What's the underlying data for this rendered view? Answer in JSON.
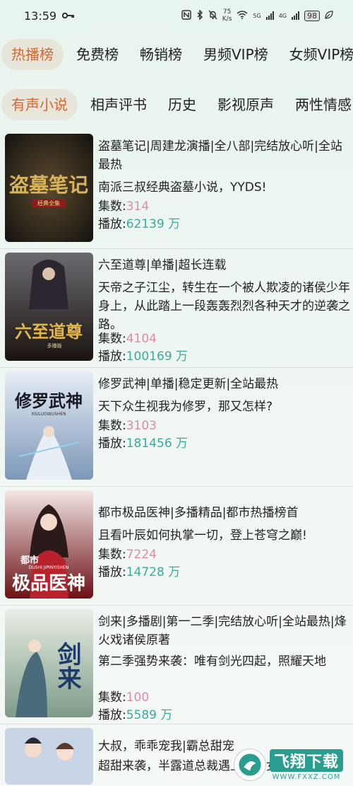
{
  "status_bar": {
    "time": "13:59",
    "net_speed_value": "75",
    "net_speed_unit": "K/s",
    "signal1_label": "5G",
    "signal2_label": "4G",
    "battery": "98"
  },
  "category_tabs": [
    "热播榜",
    "免费榜",
    "畅销榜",
    "男频VIP榜",
    "女频VIP榜"
  ],
  "genre_tabs": [
    "有声小说",
    "相声评书",
    "历史",
    "影视原声",
    "两性情感"
  ],
  "labels": {
    "episodes": "集数:",
    "plays": "播放:",
    "plays_unit": " 万"
  },
  "books": [
    {
      "title": "盗墓笔记|周建龙演播|全八部|完结放心听|全站最热",
      "desc": "南派三叔经典盗墓小说，YYDS!",
      "episodes": "314",
      "plays": "62139",
      "cover_text": "盗墓笔记",
      "cover_sub": "经典全集",
      "cover_color": "#2b2a26"
    },
    {
      "title": "六至道尊|单播|超长连载",
      "desc": "天帝之子江尘，转生在一个被人欺凌的诸侯少年身上，从此踏上一段轰轰烈烈各种天才的逆袭之路。",
      "episodes": "4104",
      "plays": "100169",
      "cover_text": "六至道尊",
      "cover_sub": "多播版",
      "cover_color": "#3b2f22"
    },
    {
      "title": "修罗武神|单播|稳定更新|全站最热",
      "desc": "天下众生视我为修罗，那又怎样?",
      "episodes": "3103",
      "plays": "181456",
      "cover_text": "修罗武神",
      "cover_sub": "XIULUOWUSHEN",
      "cover_color": "#b9c9d8"
    },
    {
      "title": "都市极品医神|多播精品|都市热播榜首",
      "desc": "且看叶辰如何执掌一切，登上苍穹之巅!",
      "episodes": "7224",
      "plays": "14728",
      "cover_text": "极品医神",
      "cover_sub": "都市",
      "cover_sub2": "DUSHI JIPINYISHEN",
      "cover_color": "#7a1f24"
    },
    {
      "title": "剑来|多播剧|第一二季|完结放心听|全站最热|烽火戏诸侯原著",
      "desc": "第二季强势来袭：唯有剑光四起，照耀天地",
      "episodes": "100",
      "plays": "5589",
      "cover_text": "剑来",
      "cover_color": "#9fb8a6"
    },
    {
      "title": "大叔，乖乖宠我|霸总甜宠",
      "desc": "超甜来袭，半露道总裁遇上小萌女",
      "cover_color": "#c8d5e6"
    }
  ],
  "watermark": {
    "main": "飞翔下载",
    "sub": "WWW.FXXZ.COM"
  },
  "colors": {
    "active_tab": "#d2672f",
    "episodes": "#e08aa8",
    "plays": "#3fa89c"
  }
}
